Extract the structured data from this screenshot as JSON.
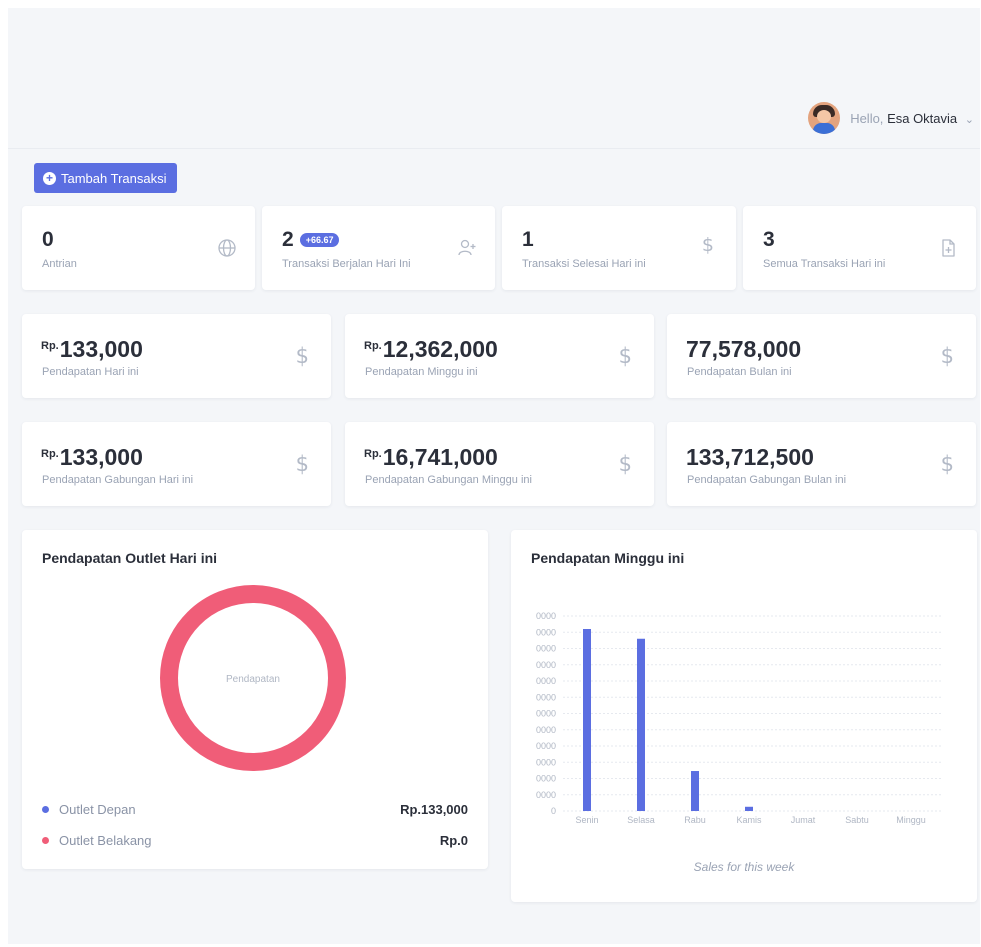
{
  "header": {
    "greeting": "Hello,",
    "user_name": "Esa Oktavia"
  },
  "toolbar": {
    "add_transaction_label": "Tambah Transaksi"
  },
  "stats": [
    {
      "value": "0",
      "badge": "",
      "label": "Antrian",
      "icon": "globe-icon"
    },
    {
      "value": "2",
      "badge": "+66.67",
      "label": "Transaksi Berjalan Hari Ini",
      "icon": "user-plus-icon"
    },
    {
      "value": "1",
      "badge": "",
      "label": "Transaksi Selesai Hari ini",
      "icon": "dollar-icon"
    },
    {
      "value": "3",
      "badge": "",
      "label": "Semua Transaksi Hari ini",
      "icon": "file-plus-icon"
    }
  ],
  "revenue": [
    {
      "currency": "Rp.",
      "amount": "133,000",
      "label": "Pendapatan Hari ini"
    },
    {
      "currency": "Rp.",
      "amount": "12,362,000",
      "label": "Pendapatan Minggu ini"
    },
    {
      "currency": "",
      "amount": "77,578,000",
      "label": "Pendapatan Bulan ini"
    }
  ],
  "combined_revenue": [
    {
      "currency": "Rp.",
      "amount": "133,000",
      "label": "Pendapatan Gabungan Hari ini"
    },
    {
      "currency": "Rp.",
      "amount": "16,741,000",
      "label": "Pendapatan Gabungan Minggu ini"
    },
    {
      "currency": "",
      "amount": "133,712,500",
      "label": "Pendapatan Gabungan Bulan ini"
    }
  ],
  "outlet_panel": {
    "title": "Pendapatan Outlet Hari ini",
    "center_label": "Pendapatan",
    "legend": [
      {
        "name": "Outlet Depan",
        "value": "Rp.133,000",
        "color": "#5b6ee1"
      },
      {
        "name": "Outlet Belakang",
        "value": "Rp.0",
        "color": "#f05d78"
      }
    ]
  },
  "week_panel": {
    "title": "Pendapatan Minggu ini",
    "caption": "Sales for this week"
  },
  "chart_data": [
    {
      "type": "pie",
      "title": "Pendapatan Outlet Hari ini",
      "categories": [
        "Outlet Depan",
        "Outlet Belakang"
      ],
      "values": [
        133000,
        0
      ],
      "colors": [
        "#5b6ee1",
        "#f05d78"
      ],
      "center_text": "Pendapatan"
    },
    {
      "type": "bar",
      "title": "Pendapatan Minggu ini",
      "categories": [
        "Senin",
        "Selasa",
        "Rabu",
        "Kamis",
        "Jumat",
        "Sabtu",
        "Minggu"
      ],
      "values": [
        5600000,
        5300000,
        1230000,
        130000,
        0,
        0,
        0
      ],
      "y_tick_labels": [
        "0",
        "0000",
        "0000",
        "0000",
        "0000",
        "0000",
        "0000",
        "0000",
        "0000",
        "0000",
        "0000",
        "0000",
        "0000"
      ],
      "ylim": [
        0,
        6000000
      ],
      "color": "#5b6ee1",
      "grid": true,
      "caption": "Sales for this week"
    }
  ]
}
